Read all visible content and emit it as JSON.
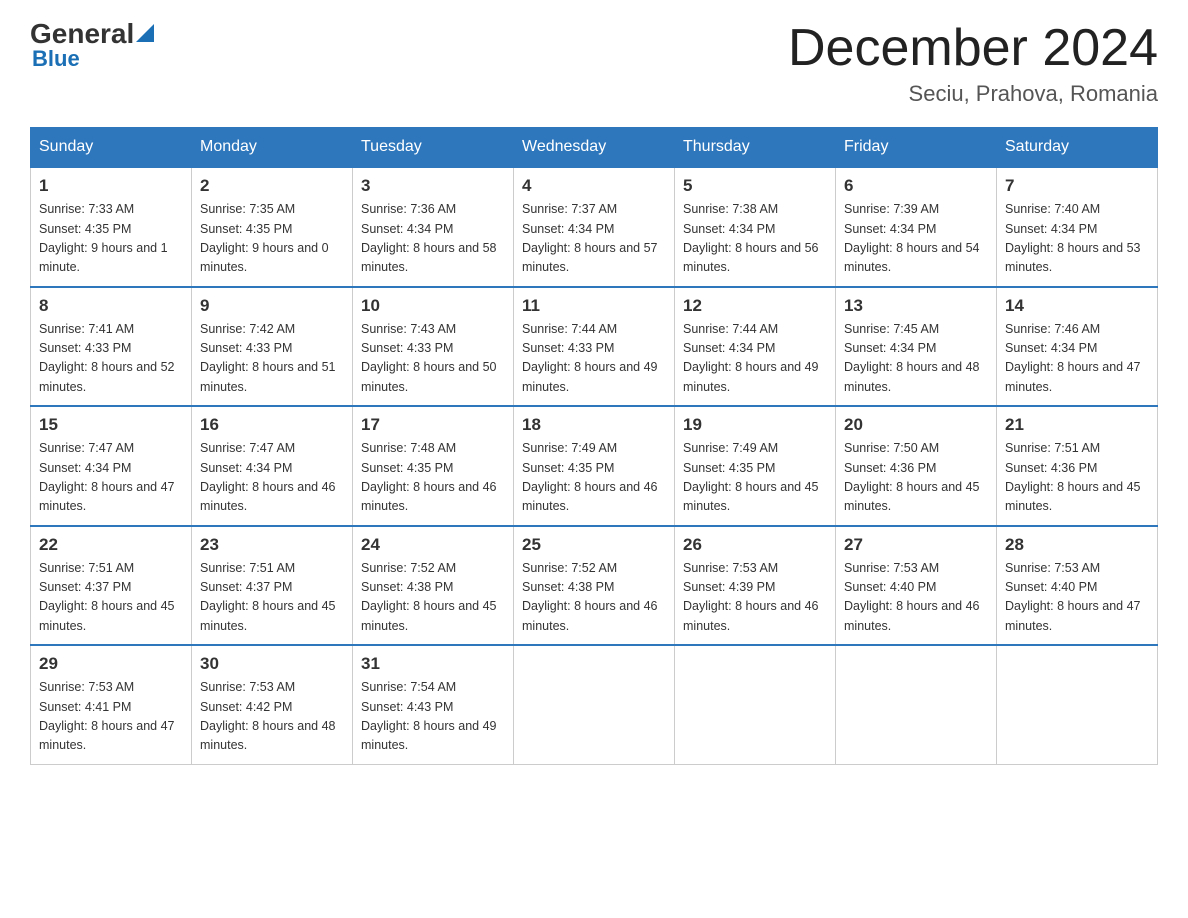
{
  "header": {
    "logo_general": "General",
    "logo_blue": "Blue",
    "month_title": "December 2024",
    "location": "Seciu, Prahova, Romania"
  },
  "days_of_week": [
    "Sunday",
    "Monday",
    "Tuesday",
    "Wednesday",
    "Thursday",
    "Friday",
    "Saturday"
  ],
  "weeks": [
    [
      {
        "day": "1",
        "sunrise": "7:33 AM",
        "sunset": "4:35 PM",
        "daylight": "9 hours and 1 minute."
      },
      {
        "day": "2",
        "sunrise": "7:35 AM",
        "sunset": "4:35 PM",
        "daylight": "9 hours and 0 minutes."
      },
      {
        "day": "3",
        "sunrise": "7:36 AM",
        "sunset": "4:34 PM",
        "daylight": "8 hours and 58 minutes."
      },
      {
        "day": "4",
        "sunrise": "7:37 AM",
        "sunset": "4:34 PM",
        "daylight": "8 hours and 57 minutes."
      },
      {
        "day": "5",
        "sunrise": "7:38 AM",
        "sunset": "4:34 PM",
        "daylight": "8 hours and 56 minutes."
      },
      {
        "day": "6",
        "sunrise": "7:39 AM",
        "sunset": "4:34 PM",
        "daylight": "8 hours and 54 minutes."
      },
      {
        "day": "7",
        "sunrise": "7:40 AM",
        "sunset": "4:34 PM",
        "daylight": "8 hours and 53 minutes."
      }
    ],
    [
      {
        "day": "8",
        "sunrise": "7:41 AM",
        "sunset": "4:33 PM",
        "daylight": "8 hours and 52 minutes."
      },
      {
        "day": "9",
        "sunrise": "7:42 AM",
        "sunset": "4:33 PM",
        "daylight": "8 hours and 51 minutes."
      },
      {
        "day": "10",
        "sunrise": "7:43 AM",
        "sunset": "4:33 PM",
        "daylight": "8 hours and 50 minutes."
      },
      {
        "day": "11",
        "sunrise": "7:44 AM",
        "sunset": "4:33 PM",
        "daylight": "8 hours and 49 minutes."
      },
      {
        "day": "12",
        "sunrise": "7:44 AM",
        "sunset": "4:34 PM",
        "daylight": "8 hours and 49 minutes."
      },
      {
        "day": "13",
        "sunrise": "7:45 AM",
        "sunset": "4:34 PM",
        "daylight": "8 hours and 48 minutes."
      },
      {
        "day": "14",
        "sunrise": "7:46 AM",
        "sunset": "4:34 PM",
        "daylight": "8 hours and 47 minutes."
      }
    ],
    [
      {
        "day": "15",
        "sunrise": "7:47 AM",
        "sunset": "4:34 PM",
        "daylight": "8 hours and 47 minutes."
      },
      {
        "day": "16",
        "sunrise": "7:47 AM",
        "sunset": "4:34 PM",
        "daylight": "8 hours and 46 minutes."
      },
      {
        "day": "17",
        "sunrise": "7:48 AM",
        "sunset": "4:35 PM",
        "daylight": "8 hours and 46 minutes."
      },
      {
        "day": "18",
        "sunrise": "7:49 AM",
        "sunset": "4:35 PM",
        "daylight": "8 hours and 46 minutes."
      },
      {
        "day": "19",
        "sunrise": "7:49 AM",
        "sunset": "4:35 PM",
        "daylight": "8 hours and 45 minutes."
      },
      {
        "day": "20",
        "sunrise": "7:50 AM",
        "sunset": "4:36 PM",
        "daylight": "8 hours and 45 minutes."
      },
      {
        "day": "21",
        "sunrise": "7:51 AM",
        "sunset": "4:36 PM",
        "daylight": "8 hours and 45 minutes."
      }
    ],
    [
      {
        "day": "22",
        "sunrise": "7:51 AM",
        "sunset": "4:37 PM",
        "daylight": "8 hours and 45 minutes."
      },
      {
        "day": "23",
        "sunrise": "7:51 AM",
        "sunset": "4:37 PM",
        "daylight": "8 hours and 45 minutes."
      },
      {
        "day": "24",
        "sunrise": "7:52 AM",
        "sunset": "4:38 PM",
        "daylight": "8 hours and 45 minutes."
      },
      {
        "day": "25",
        "sunrise": "7:52 AM",
        "sunset": "4:38 PM",
        "daylight": "8 hours and 46 minutes."
      },
      {
        "day": "26",
        "sunrise": "7:53 AM",
        "sunset": "4:39 PM",
        "daylight": "8 hours and 46 minutes."
      },
      {
        "day": "27",
        "sunrise": "7:53 AM",
        "sunset": "4:40 PM",
        "daylight": "8 hours and 46 minutes."
      },
      {
        "day": "28",
        "sunrise": "7:53 AM",
        "sunset": "4:40 PM",
        "daylight": "8 hours and 47 minutes."
      }
    ],
    [
      {
        "day": "29",
        "sunrise": "7:53 AM",
        "sunset": "4:41 PM",
        "daylight": "8 hours and 47 minutes."
      },
      {
        "day": "30",
        "sunrise": "7:53 AM",
        "sunset": "4:42 PM",
        "daylight": "8 hours and 48 minutes."
      },
      {
        "day": "31",
        "sunrise": "7:54 AM",
        "sunset": "4:43 PM",
        "daylight": "8 hours and 49 minutes."
      },
      null,
      null,
      null,
      null
    ]
  ]
}
